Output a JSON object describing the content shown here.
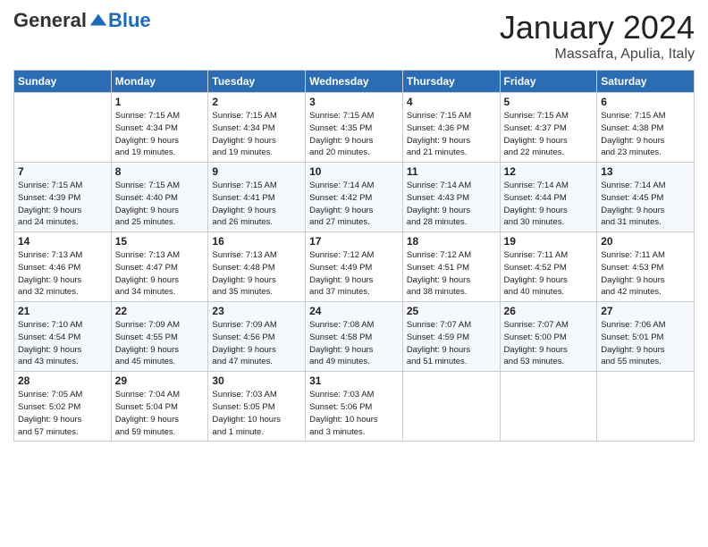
{
  "header": {
    "logo_general": "General",
    "logo_blue": "Blue",
    "month_title": "January 2024",
    "location": "Massafra, Apulia, Italy"
  },
  "days_of_week": [
    "Sunday",
    "Monday",
    "Tuesday",
    "Wednesday",
    "Thursday",
    "Friday",
    "Saturday"
  ],
  "weeks": [
    [
      {
        "day": "",
        "info": ""
      },
      {
        "day": "1",
        "info": "Sunrise: 7:15 AM\nSunset: 4:34 PM\nDaylight: 9 hours\nand 19 minutes."
      },
      {
        "day": "2",
        "info": "Sunrise: 7:15 AM\nSunset: 4:34 PM\nDaylight: 9 hours\nand 19 minutes."
      },
      {
        "day": "3",
        "info": "Sunrise: 7:15 AM\nSunset: 4:35 PM\nDaylight: 9 hours\nand 20 minutes."
      },
      {
        "day": "4",
        "info": "Sunrise: 7:15 AM\nSunset: 4:36 PM\nDaylight: 9 hours\nand 21 minutes."
      },
      {
        "day": "5",
        "info": "Sunrise: 7:15 AM\nSunset: 4:37 PM\nDaylight: 9 hours\nand 22 minutes."
      },
      {
        "day": "6",
        "info": "Sunrise: 7:15 AM\nSunset: 4:38 PM\nDaylight: 9 hours\nand 23 minutes."
      }
    ],
    [
      {
        "day": "7",
        "info": "Sunrise: 7:15 AM\nSunset: 4:39 PM\nDaylight: 9 hours\nand 24 minutes."
      },
      {
        "day": "8",
        "info": "Sunrise: 7:15 AM\nSunset: 4:40 PM\nDaylight: 9 hours\nand 25 minutes."
      },
      {
        "day": "9",
        "info": "Sunrise: 7:15 AM\nSunset: 4:41 PM\nDaylight: 9 hours\nand 26 minutes."
      },
      {
        "day": "10",
        "info": "Sunrise: 7:14 AM\nSunset: 4:42 PM\nDaylight: 9 hours\nand 27 minutes."
      },
      {
        "day": "11",
        "info": "Sunrise: 7:14 AM\nSunset: 4:43 PM\nDaylight: 9 hours\nand 28 minutes."
      },
      {
        "day": "12",
        "info": "Sunrise: 7:14 AM\nSunset: 4:44 PM\nDaylight: 9 hours\nand 30 minutes."
      },
      {
        "day": "13",
        "info": "Sunrise: 7:14 AM\nSunset: 4:45 PM\nDaylight: 9 hours\nand 31 minutes."
      }
    ],
    [
      {
        "day": "14",
        "info": "Sunrise: 7:13 AM\nSunset: 4:46 PM\nDaylight: 9 hours\nand 32 minutes."
      },
      {
        "day": "15",
        "info": "Sunrise: 7:13 AM\nSunset: 4:47 PM\nDaylight: 9 hours\nand 34 minutes."
      },
      {
        "day": "16",
        "info": "Sunrise: 7:13 AM\nSunset: 4:48 PM\nDaylight: 9 hours\nand 35 minutes."
      },
      {
        "day": "17",
        "info": "Sunrise: 7:12 AM\nSunset: 4:49 PM\nDaylight: 9 hours\nand 37 minutes."
      },
      {
        "day": "18",
        "info": "Sunrise: 7:12 AM\nSunset: 4:51 PM\nDaylight: 9 hours\nand 38 minutes."
      },
      {
        "day": "19",
        "info": "Sunrise: 7:11 AM\nSunset: 4:52 PM\nDaylight: 9 hours\nand 40 minutes."
      },
      {
        "day": "20",
        "info": "Sunrise: 7:11 AM\nSunset: 4:53 PM\nDaylight: 9 hours\nand 42 minutes."
      }
    ],
    [
      {
        "day": "21",
        "info": "Sunrise: 7:10 AM\nSunset: 4:54 PM\nDaylight: 9 hours\nand 43 minutes."
      },
      {
        "day": "22",
        "info": "Sunrise: 7:09 AM\nSunset: 4:55 PM\nDaylight: 9 hours\nand 45 minutes."
      },
      {
        "day": "23",
        "info": "Sunrise: 7:09 AM\nSunset: 4:56 PM\nDaylight: 9 hours\nand 47 minutes."
      },
      {
        "day": "24",
        "info": "Sunrise: 7:08 AM\nSunset: 4:58 PM\nDaylight: 9 hours\nand 49 minutes."
      },
      {
        "day": "25",
        "info": "Sunrise: 7:07 AM\nSunset: 4:59 PM\nDaylight: 9 hours\nand 51 minutes."
      },
      {
        "day": "26",
        "info": "Sunrise: 7:07 AM\nSunset: 5:00 PM\nDaylight: 9 hours\nand 53 minutes."
      },
      {
        "day": "27",
        "info": "Sunrise: 7:06 AM\nSunset: 5:01 PM\nDaylight: 9 hours\nand 55 minutes."
      }
    ],
    [
      {
        "day": "28",
        "info": "Sunrise: 7:05 AM\nSunset: 5:02 PM\nDaylight: 9 hours\nand 57 minutes."
      },
      {
        "day": "29",
        "info": "Sunrise: 7:04 AM\nSunset: 5:04 PM\nDaylight: 9 hours\nand 59 minutes."
      },
      {
        "day": "30",
        "info": "Sunrise: 7:03 AM\nSunset: 5:05 PM\nDaylight: 10 hours\nand 1 minute."
      },
      {
        "day": "31",
        "info": "Sunrise: 7:03 AM\nSunset: 5:06 PM\nDaylight: 10 hours\nand 3 minutes."
      },
      {
        "day": "",
        "info": ""
      },
      {
        "day": "",
        "info": ""
      },
      {
        "day": "",
        "info": ""
      }
    ]
  ]
}
